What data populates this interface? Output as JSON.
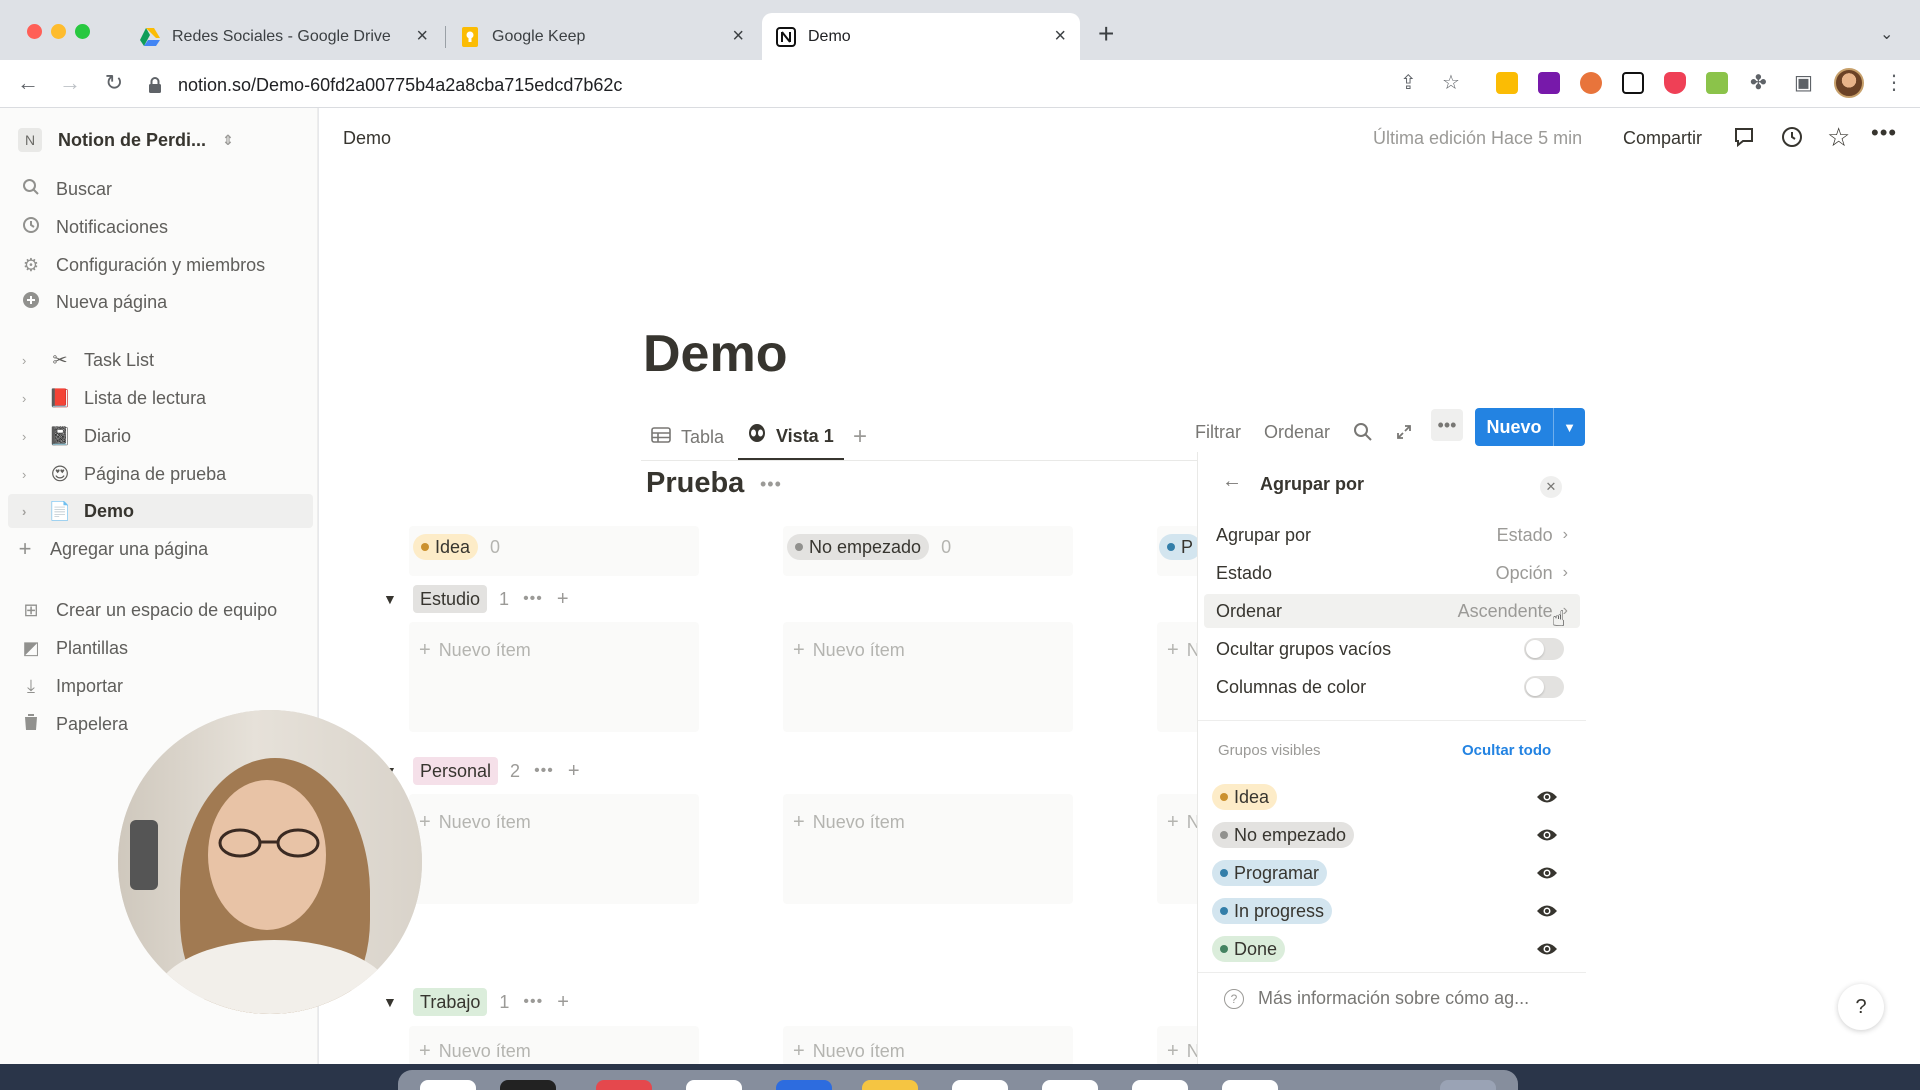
{
  "browser": {
    "tabs": [
      {
        "title": "Redes Sociales - Google Drive",
        "icon": "google-drive-icon"
      },
      {
        "title": "Google Keep",
        "icon": "google-keep-icon"
      },
      {
        "title": "Demo",
        "icon": "notion-icon"
      }
    ],
    "url": "notion.so/Demo-60fd2a00775b4a2a8cba715edcd7b62c"
  },
  "sidebar": {
    "workspace_initial": "N",
    "workspace_name": "Notion de Perdi...",
    "actions": [
      {
        "label": "Buscar",
        "icon": "search-icon"
      },
      {
        "label": "Notificaciones",
        "icon": "clock-icon"
      },
      {
        "label": "Configuración y miembros",
        "icon": "gear-icon"
      },
      {
        "label": "Nueva página",
        "icon": "plus-circle-icon"
      }
    ],
    "pages": [
      {
        "label": "Task List",
        "icon": "✂"
      },
      {
        "label": "Lista de lectura",
        "icon": "📕"
      },
      {
        "label": "Diario",
        "icon": "📓"
      },
      {
        "label": "Página de prueba",
        "icon": "😍"
      },
      {
        "label": "Demo",
        "icon": "📄"
      }
    ],
    "add_page": "Agregar una página",
    "bottom": [
      {
        "label": "Crear un espacio de equipo",
        "icon": "team-icon"
      },
      {
        "label": "Plantillas",
        "icon": "templates-icon"
      },
      {
        "label": "Importar",
        "icon": "download-icon"
      },
      {
        "label": "Papelera",
        "icon": "trash-icon"
      }
    ]
  },
  "topbar": {
    "breadcrumb": "Demo",
    "last_edit": "Última edición Hace 5 min",
    "share": "Compartir"
  },
  "page": {
    "title": "Demo",
    "views": [
      {
        "label": "Tabla",
        "icon": "table-icon"
      },
      {
        "label": "Vista 1",
        "icon": "alien-icon"
      }
    ],
    "toolbar": {
      "filter": "Filtrar",
      "sort": "Ordenar",
      "new": "Nuevo"
    },
    "db_title": "Prueba",
    "columns": [
      {
        "label": "Idea",
        "count": "0",
        "color": "#fdecc8",
        "dot": "#cb912f"
      },
      {
        "label": "No empezado",
        "count": "0",
        "color": "#e3e2e0",
        "dot": "#91918e"
      },
      {
        "label": "P",
        "color": "#d3e5ef",
        "dot": "#337ea9"
      }
    ],
    "groups": [
      {
        "label": "Estudio",
        "count": "1",
        "color": "#e3e2e0"
      },
      {
        "label": "Personal",
        "count": "2",
        "color": "#f5e0e9"
      },
      {
        "label": "Trabajo",
        "count": "1",
        "color": "#dbeddb"
      }
    ],
    "new_item": "Nuevo ítem",
    "new_item_cut": "N"
  },
  "panel": {
    "title": "Agrupar por",
    "rows": [
      {
        "label": "Agrupar por",
        "value": "Estado"
      },
      {
        "label": "Estado",
        "value": "Opción"
      },
      {
        "label": "Ordenar",
        "value": "Ascendente"
      }
    ],
    "toggles": [
      {
        "label": "Ocultar grupos vacíos",
        "on": false
      },
      {
        "label": "Columnas de color",
        "on": false
      }
    ],
    "visible_groups_label": "Grupos visibles",
    "hide_all": "Ocultar todo",
    "visible_groups": [
      {
        "label": "Idea",
        "color": "#fdecc8",
        "dot": "#cb912f"
      },
      {
        "label": "No empezado",
        "color": "#e3e2e0",
        "dot": "#91918e"
      },
      {
        "label": "Programar",
        "color": "#d3e5ef",
        "dot": "#337ea9"
      },
      {
        "label": "In progress",
        "color": "#d3e5ef",
        "dot": "#337ea9"
      },
      {
        "label": "Done",
        "color": "#dbeddb",
        "dot": "#448361"
      }
    ],
    "info": "Más información sobre cómo ag..."
  },
  "help": "?"
}
